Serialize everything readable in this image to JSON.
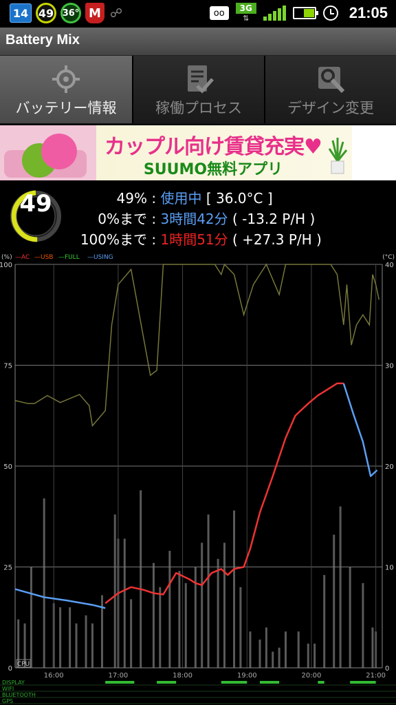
{
  "status_bar": {
    "icons": [
      "calendar-icon",
      "battery-mix-icon",
      "temperature-icon",
      "mcafee-icon",
      "usb-debug-icon",
      "voicemail-icon",
      "network-3g-icon",
      "signal-icon",
      "battery-icon",
      "alarm-icon"
    ],
    "calendar_day": "14",
    "battery_ring": "49",
    "temp_ring": "36°",
    "mcafee_letter": "M",
    "network": "3G",
    "time": "21:05"
  },
  "app": {
    "title": "Battery Mix"
  },
  "tabs": [
    {
      "label": "バッテリー情報",
      "icon": "target-icon",
      "active": true
    },
    {
      "label": "稼働プロセス",
      "icon": "checklist-icon",
      "active": false
    },
    {
      "label": "デザイン変更",
      "icon": "wrench-icon",
      "active": false
    }
  ],
  "ad": {
    "title": "カップル向け賃貸充実",
    "heart": "♥",
    "subtitle": "SUUMO無料アプリ"
  },
  "battery": {
    "level": "49",
    "line1": {
      "percent": "49%",
      "sep": ":",
      "state": "使用中",
      "temp": "[ 36.0°C ]"
    },
    "line2": {
      "label": "0%まで",
      "sep": ":",
      "time": "3時間42分",
      "rate": "( -13.2 P/H )"
    },
    "line3": {
      "label": "100%まで",
      "sep": ":",
      "time": "1時間51分",
      "rate": "( +27.3 P/H )"
    }
  },
  "colors": {
    "ac": "#ee3333",
    "usb": "#ee5500",
    "full": "#33cc33",
    "using": "#5b9ff5",
    "temp_line": "#77773a",
    "level_gauge": "#d9e21a"
  },
  "chart_data": {
    "type": "line",
    "left_unit": "(%)",
    "right_unit": "(°C)",
    "legend": [
      "AC",
      "USB",
      "FULL",
      "USING"
    ],
    "y_ticks_left": [
      "100",
      "75",
      "50",
      "25",
      "0"
    ],
    "y_ticks_right": [
      "40",
      "30",
      "20",
      "10",
      "0"
    ],
    "x_ticks": [
      "16:00",
      "17:00",
      "18:00",
      "19:00",
      "20:00",
      "21:00"
    ],
    "ylim_left": [
      0,
      100
    ],
    "ylim_right": [
      0,
      40
    ],
    "xlim": [
      15.4,
      21.1
    ],
    "battery_series": [
      {
        "name": "USING",
        "x": [
          15.4,
          15.85,
          16.2,
          16.6,
          16.8
        ],
        "y": [
          19.5,
          17.5,
          16.7,
          15.6,
          14.8
        ]
      },
      {
        "name": "AC",
        "x": [
          16.8,
          17.0,
          17.2,
          17.4,
          17.55,
          17.7,
          17.9,
          18.1,
          18.2,
          18.3,
          18.45,
          18.6,
          18.7,
          18.8,
          18.95,
          19.05,
          19.2,
          19.4,
          19.6,
          19.75,
          19.95,
          20.1,
          20.25,
          20.4,
          20.5
        ],
        "y": [
          16,
          18.5,
          20,
          19.3,
          18.5,
          18.2,
          23.5,
          22,
          21,
          20.5,
          23.5,
          24.5,
          23,
          24.5,
          25,
          29.5,
          38.5,
          47.5,
          57,
          62.5,
          65.5,
          67.5,
          69,
          70.5,
          70.5
        ]
      },
      {
        "name": "USING",
        "x": [
          20.5,
          20.65,
          20.8,
          20.92,
          21.02
        ],
        "y": [
          70.5,
          63,
          56,
          47.5,
          49
        ]
      }
    ],
    "temp_series": {
      "name": "temp",
      "x": [
        15.4,
        15.6,
        15.7,
        15.9,
        16.1,
        16.4,
        16.55,
        16.6,
        16.8,
        16.9,
        17.0,
        17.2,
        17.5,
        17.6,
        17.7,
        17.9,
        18.0,
        18.1,
        18.2,
        18.5,
        18.6,
        18.65,
        18.8,
        18.95,
        19.1,
        19.2,
        19.3,
        19.5,
        19.6,
        19.9,
        20.3,
        20.4,
        20.5,
        20.55,
        20.62,
        20.7,
        20.8,
        20.9,
        20.95,
        21.0,
        21.05
      ],
      "y": [
        26.5,
        26.2,
        26.2,
        27,
        26.3,
        27.1,
        26,
        24,
        25.5,
        34,
        38,
        39.5,
        29,
        29.5,
        40,
        40,
        40,
        40,
        40,
        40,
        39,
        40,
        39,
        35,
        38,
        39,
        40,
        37,
        40,
        40,
        40,
        39,
        34,
        38,
        32,
        34,
        35,
        34,
        39,
        38,
        36.5
      ]
    },
    "bar_series": {
      "name": "CPU",
      "x": [
        15.45,
        15.55,
        15.65,
        15.85,
        16.0,
        16.1,
        16.25,
        16.35,
        16.5,
        16.6,
        16.75,
        16.95,
        17.0,
        17.1,
        17.2,
        17.35,
        17.55,
        17.65,
        17.8,
        17.95,
        18.05,
        18.2,
        18.3,
        18.4,
        18.55,
        18.65,
        18.8,
        18.9,
        19.05,
        19.2,
        19.3,
        19.4,
        19.5,
        19.6,
        19.8,
        19.95,
        20.05,
        20.2,
        20.35,
        20.45,
        20.6,
        20.8,
        20.95,
        21.0
      ],
      "y": [
        12,
        11,
        25,
        42,
        16,
        15,
        15,
        11,
        13,
        11,
        18,
        38,
        32,
        32,
        17,
        44,
        26,
        20,
        29,
        24,
        21,
        25,
        31,
        38,
        27,
        31,
        39,
        20,
        9,
        7,
        10,
        4,
        5,
        9,
        9,
        6,
        6,
        23,
        33,
        40,
        25,
        21,
        10,
        9
      ]
    },
    "state_bands": [
      "DISPLAY",
      "WIFI",
      "BLUETOOTH",
      "GPS"
    ],
    "cpu_label": "CPU"
  }
}
